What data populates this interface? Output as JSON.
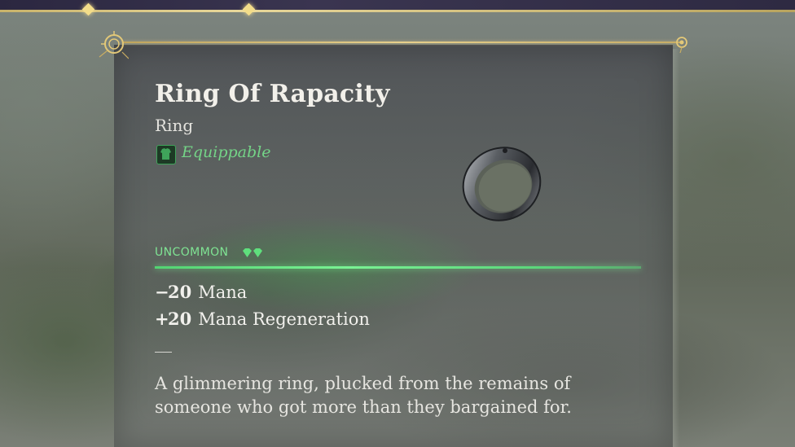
{
  "item": {
    "name": "Ring Of Rapacity",
    "type": "Ring",
    "equip_status": "Equippable",
    "rarity": "UNCOMMON",
    "stats": [
      {
        "sign": "−",
        "value": "20",
        "label": "Mana"
      },
      {
        "sign": "+",
        "value": "20",
        "label": "Mana Regeneration"
      }
    ],
    "description": "A glimmering ring, plucked from the remains of someone who got more than they bargained for."
  },
  "colors": {
    "rarity_uncommon": "#7fe393",
    "equippable": "#74d487",
    "accent_gold": "#e7d08c"
  },
  "icons": {
    "equip": "armor-shirt-icon",
    "rarity_gem": "gem-icon",
    "item": "ring-icon"
  }
}
